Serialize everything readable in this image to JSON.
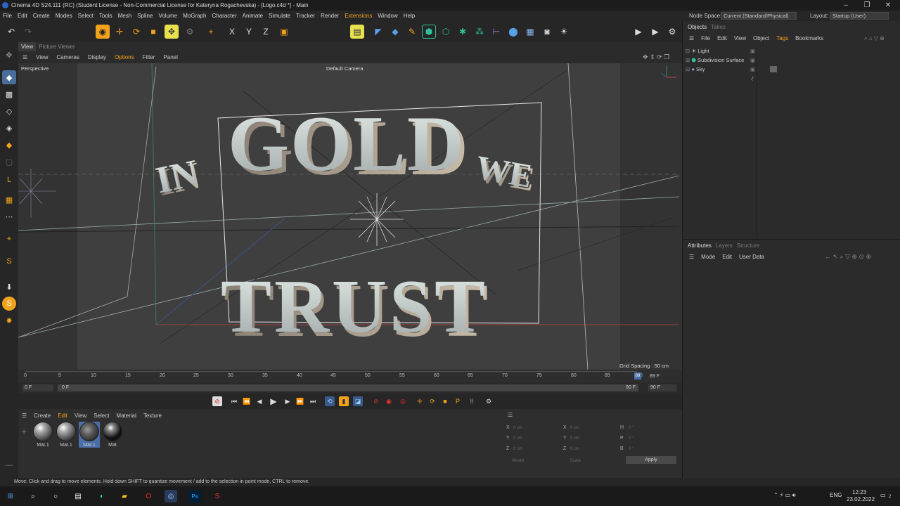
{
  "window": {
    "title": "Cinema 4D S24.111 (RC) (Student License - Non-Commercial License for Kateryna Rogachevska) - [Logo.c4d *] - Main",
    "minimize": "–",
    "restore": "❐",
    "close": "✕"
  },
  "menu": {
    "items": [
      "File",
      "Edit",
      "Create",
      "Modes",
      "Select",
      "Tools",
      "Mesh",
      "Spline",
      "Volume",
      "MoGraph",
      "Character",
      "Animate",
      "Simulate",
      "Tracker",
      "Render",
      "Extensions",
      "Window",
      "Help"
    ],
    "node_space_label": "Node Space:",
    "node_space_value": "Current (Standard/Physical)",
    "layout_label": "Layout:",
    "layout_value": "Startup (User)"
  },
  "viewport": {
    "tabs": [
      "View",
      "Picture Viewer"
    ],
    "menu": [
      "View",
      "Cameras",
      "Display",
      "Options",
      "Filter",
      "Panel"
    ],
    "projection": "Perspective",
    "camera": "Default Camera",
    "grid_spacing": "Grid Spacing : 50 cm",
    "scene_text_top": [
      "IN",
      "GOLD",
      "WE"
    ],
    "scene_text_bottom": "TRUST"
  },
  "timeline": {
    "ticks": [
      "0",
      "5",
      "10",
      "15",
      "20",
      "25",
      "30",
      "35",
      "40",
      "45",
      "50",
      "55",
      "60",
      "65",
      "70",
      "75",
      "80",
      "85",
      "90"
    ],
    "current_frame_field": "0 F",
    "range_start": "0 F",
    "range_end": "90 F",
    "end_field": "90 F",
    "playhead_frame": "89",
    "playhead_field": "89 F"
  },
  "material_manager": {
    "menu": [
      "Create",
      "Edit",
      "View",
      "Select",
      "Material",
      "Texture"
    ],
    "materials": [
      {
        "name": "Mat.1"
      },
      {
        "name": "Mat.1"
      },
      {
        "name": "Mat.1"
      },
      {
        "name": "Mat"
      }
    ]
  },
  "coordinates": {
    "axes": [
      "X",
      "Y",
      "Z"
    ],
    "rot_axes": [
      "H",
      "P",
      "B"
    ],
    "pos_values": [
      "0 cm",
      "0 cm",
      "0 cm"
    ],
    "size_values": [
      "0 cm",
      "0 cm",
      "0 cm"
    ],
    "rot_values": [
      "0 °",
      "0 °",
      "0 °"
    ],
    "mode_select": "World",
    "size_select": "Scale",
    "apply_label": "Apply"
  },
  "objects_panel": {
    "tabs": [
      "Objects",
      "Takes"
    ],
    "menu": [
      "File",
      "Edit",
      "View",
      "Object",
      "Tags",
      "Bookmarks"
    ],
    "objects": [
      "Light",
      "Subdivision Surface",
      "Sky"
    ]
  },
  "attributes_panel": {
    "tabs": [
      "Attributes",
      "Layers",
      "Structure"
    ],
    "menu": [
      "Mode",
      "Edit",
      "User Data"
    ]
  },
  "status_text": "Move: Click and drag to move elements. Hold down SHIFT to quantize movement / add to the selection in point mode, CTRL to remove.",
  "taskbar": {
    "lang": "ENG",
    "time": "12:23",
    "date": "23.02.2022",
    "notif_count": "2"
  },
  "colors": {
    "accent": "#f2a31b",
    "toolbar_yellow": "#e8e04c",
    "toolbar_teal": "#2fbf9a",
    "model": "#b8c0bd"
  }
}
